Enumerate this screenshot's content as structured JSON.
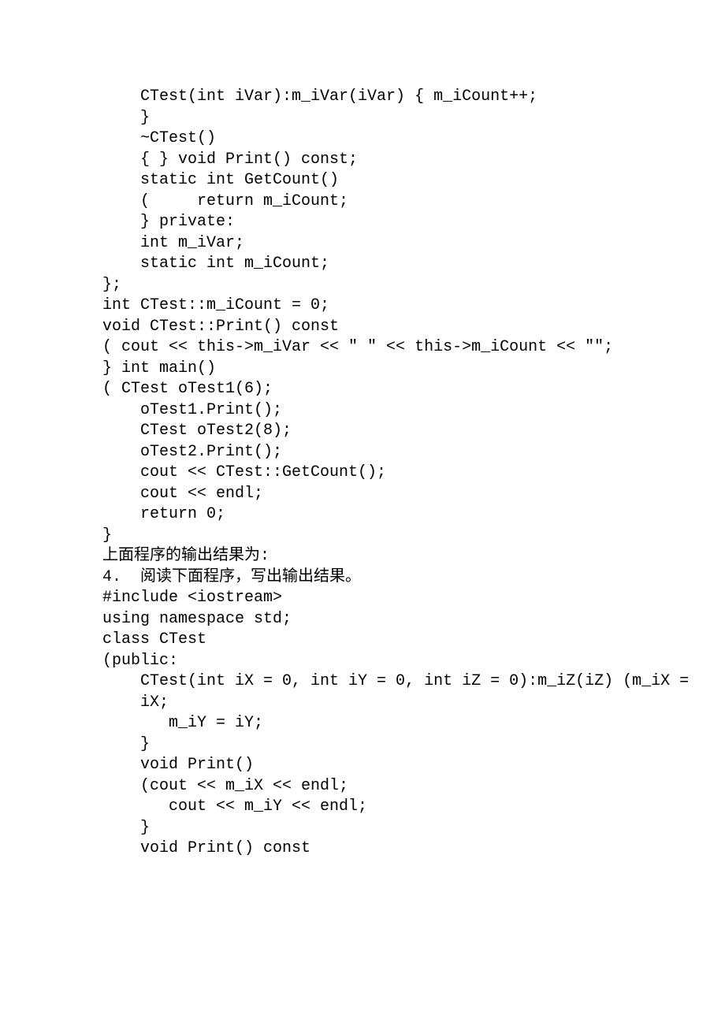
{
  "lines": [
    "    CTest(int iVar):m_iVar(iVar) { m_iCount++;",
    "    }",
    "    ~CTest()",
    "    { } void Print() const;",
    "    static int GetCount()",
    "    (     return m_iCount;",
    "    } private:",
    "    int m_iVar;",
    "    static int m_iCount;",
    "};",
    "int CTest::m_iCount = 0;",
    "void CTest::Print() const",
    "( cout << this->m_iVar << \" \" << this->m_iCount << \"\";",
    "} int main()",
    "( CTest oTest1(6);",
    "    oTest1.Print();",
    "    CTest oTest2(8);",
    "    oTest2.Print();",
    "    cout << CTest::GetCount();",
    "    cout << endl;",
    "    return 0;",
    "}",
    "上面程序的输出结果为:",
    "",
    "4.  阅读下面程序，写出输出结果。",
    "#include <iostream>",
    "using namespace std;",
    "class CTest",
    "(public:",
    "    CTest(int iX = 0, int iY = 0, int iZ = 0):m_iZ(iZ) (m_iX =",
    "    iX;",
    "       m_iY = iY;",
    "    }",
    "    void Print()",
    "    (cout << m_iX << endl;",
    "       cout << m_iY << endl;",
    "    }",
    "    void Print() const"
  ]
}
